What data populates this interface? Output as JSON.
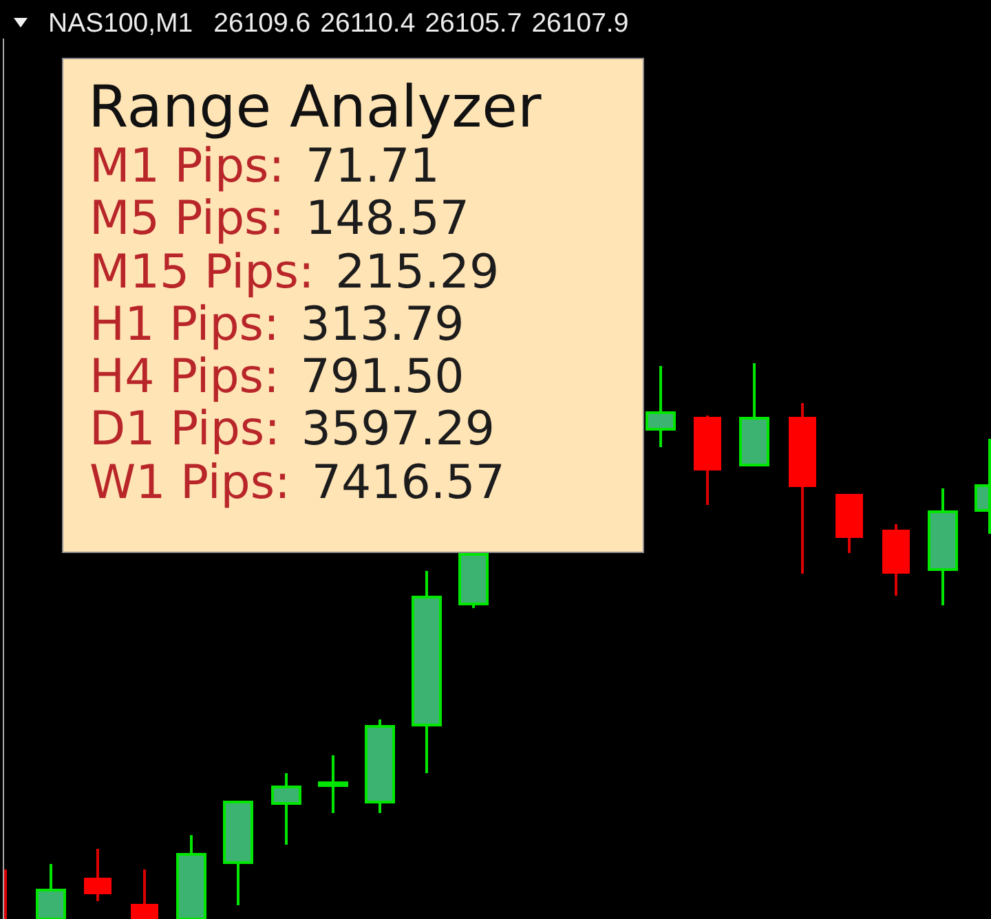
{
  "chart_header": {
    "symbol": "NAS100,M1",
    "prices": [
      "26109.6",
      "26110.4",
      "26105.7",
      "26107.9"
    ]
  },
  "range_panel": {
    "title": "Range Analyzer",
    "rows": [
      {
        "label": "M1 Pips:",
        "value": "71.71"
      },
      {
        "label": "M5 Pips:",
        "value": "148.57"
      },
      {
        "label": "M15 Pips:",
        "value": "215.29"
      },
      {
        "label": "H1 Pips:",
        "value": "313.79"
      },
      {
        "label": "H4 Pips:",
        "value": "791.50"
      },
      {
        "label": "D1 Pips:",
        "value": "3597.29"
      },
      {
        "label": "W1 Pips:",
        "value": "7416.57"
      }
    ]
  }
}
